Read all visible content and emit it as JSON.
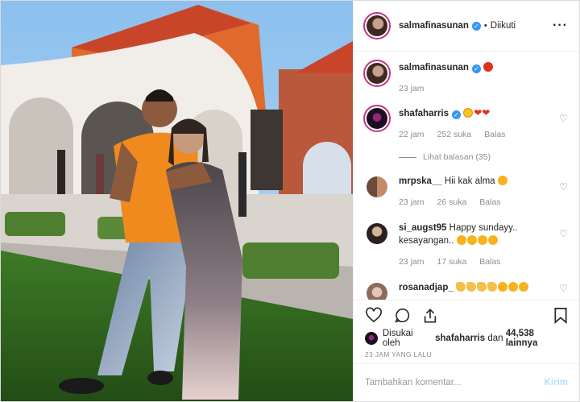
{
  "header": {
    "username": "salmafinasunan",
    "follow_status": "Diikuti",
    "more_icon": "ellipsis-icon"
  },
  "caption": {
    "username": "salmafinasunan",
    "emoji": "devil-emoji",
    "time": "23 jam"
  },
  "comments": [
    {
      "username": "shafaharris",
      "verified": true,
      "text": "",
      "emojis": [
        "sad-face-emoji",
        "red-heart-emoji",
        "red-heart-emoji"
      ],
      "time": "22 jam",
      "likes": "252 suka",
      "reply": "Balas",
      "view_replies": "Lihat balasan (35)"
    },
    {
      "username": "mrpska__",
      "text": "Hii kak alma",
      "emojis": [
        "heart-eyes-emoji"
      ],
      "time": "23 jam",
      "likes": "26 suka",
      "reply": "Balas"
    },
    {
      "username": "si_augst95",
      "text": "Happy sundayy.. kesayangan..",
      "emojis": [
        "heart-eyes-emoji",
        "heart-eyes-emoji",
        "heart-eyes-emoji",
        "heart-eyes-emoji"
      ],
      "time": "23 jam",
      "likes": "17 suka",
      "reply": "Balas"
    },
    {
      "username": "rosanadjap_",
      "text": "",
      "emojis": [
        "clap-emoji",
        "clap-emoji",
        "clap-emoji",
        "clap-emoji",
        "heart-eyes-emoji",
        "heart-eyes-emoji",
        "heart-eyes-emoji"
      ]
    }
  ],
  "actions": {
    "like_icon": "heart-outline-icon",
    "comment_icon": "comment-icon",
    "share_icon": "share-icon",
    "save_icon": "bookmark-icon"
  },
  "likes_line": {
    "prefix": "Disukai oleh",
    "user": "shafaharris",
    "conjunction": "dan",
    "count": "44,538 lainnya"
  },
  "timestamp": "23 JAM YANG LALU",
  "add_comment": {
    "placeholder": "Tambahkan komentar...",
    "post_label": "Kirim"
  },
  "colors": {
    "verified": "#3897f0",
    "post_button": "#b2dffc",
    "story_ring": "#c13584"
  }
}
